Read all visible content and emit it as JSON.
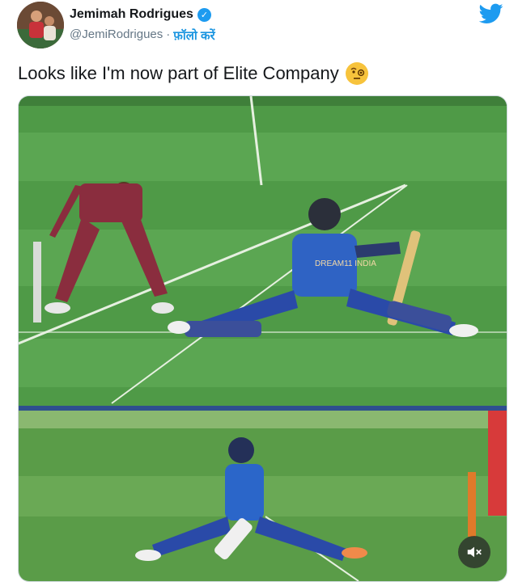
{
  "tweet": {
    "author_name": "Jemimah Rodrigues",
    "handle": "@JemiRodrigues",
    "separator": "·",
    "follow_label": "फ़ॉलो करें",
    "text": "Looks like I'm now part of Elite Company"
  },
  "media": {
    "shirt_text": "DREAM11 INDIA"
  },
  "icons": {
    "verified": "verified-badge-icon",
    "brand": "twitter-bird-icon",
    "emoji": "face-with-monocle-emoji-icon",
    "mute": "speaker-muted-icon"
  },
  "colors": {
    "brand_blue": "#1d9bf0",
    "follow_blue": "#1b95e0",
    "pitch_green": "#4f9a47",
    "india_blue": "#2f63c4",
    "wi_maroon": "#8a2d3e"
  }
}
